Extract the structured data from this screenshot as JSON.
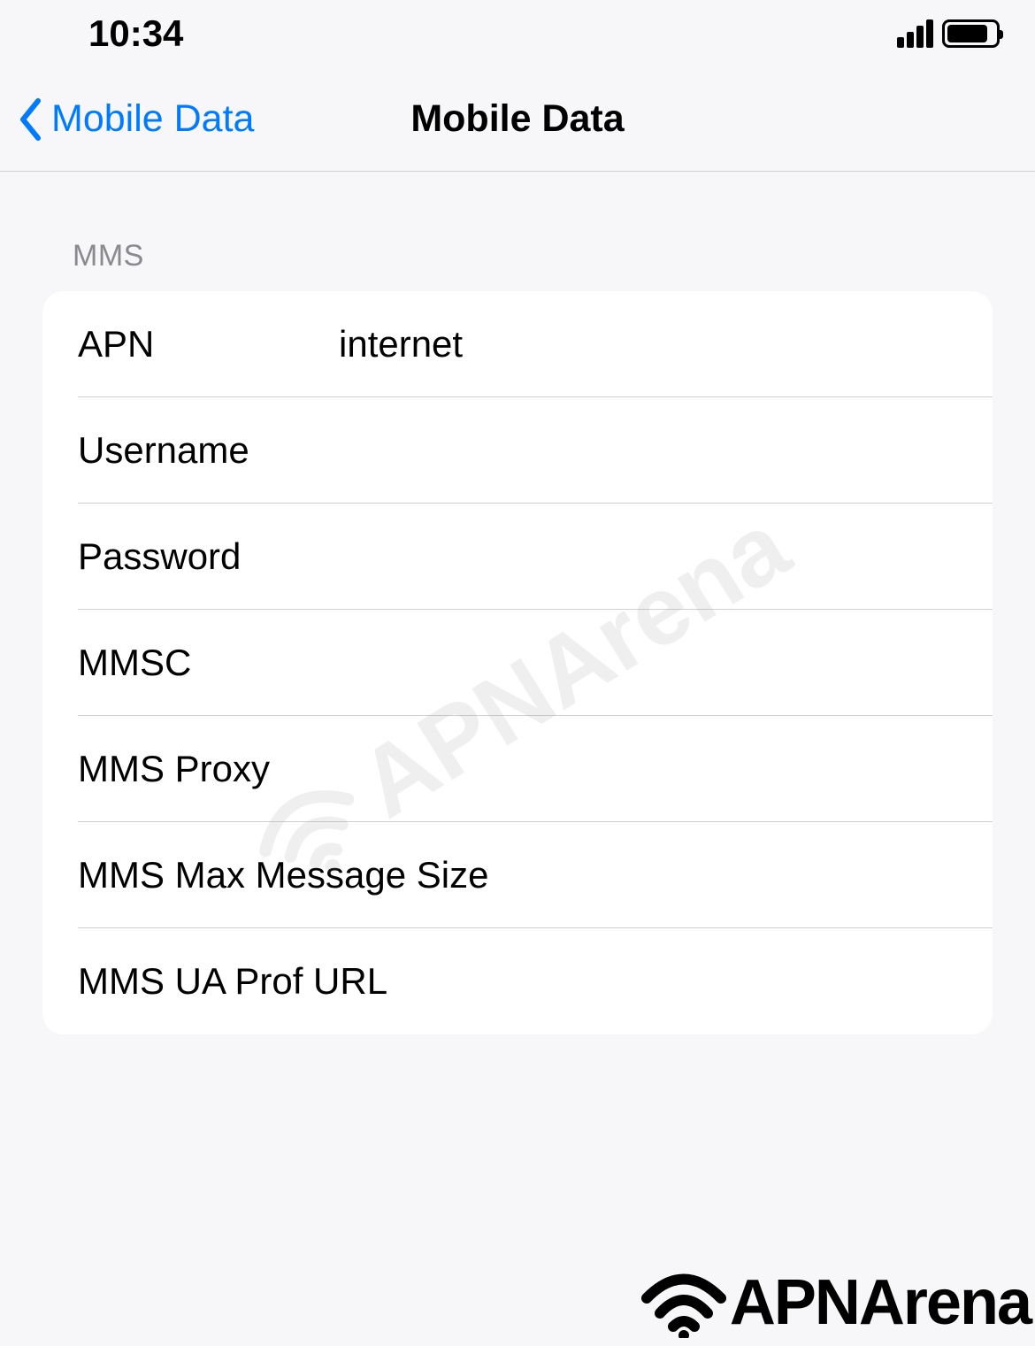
{
  "status_bar": {
    "time": "10:34"
  },
  "nav": {
    "back_label": "Mobile Data",
    "title": "Mobile Data"
  },
  "section": {
    "header": "MMS",
    "rows": {
      "apn": {
        "label": "APN",
        "value": "internet"
      },
      "username": {
        "label": "Username",
        "value": ""
      },
      "password": {
        "label": "Password",
        "value": ""
      },
      "mmsc": {
        "label": "MMSC",
        "value": ""
      },
      "mms_proxy": {
        "label": "MMS Proxy",
        "value": ""
      },
      "mms_max_size": {
        "label": "MMS Max Message Size",
        "value": ""
      },
      "mms_ua_prof_url": {
        "label": "MMS UA Prof URL",
        "value": ""
      }
    }
  },
  "watermark": "APNArena",
  "brand": "APNArena"
}
